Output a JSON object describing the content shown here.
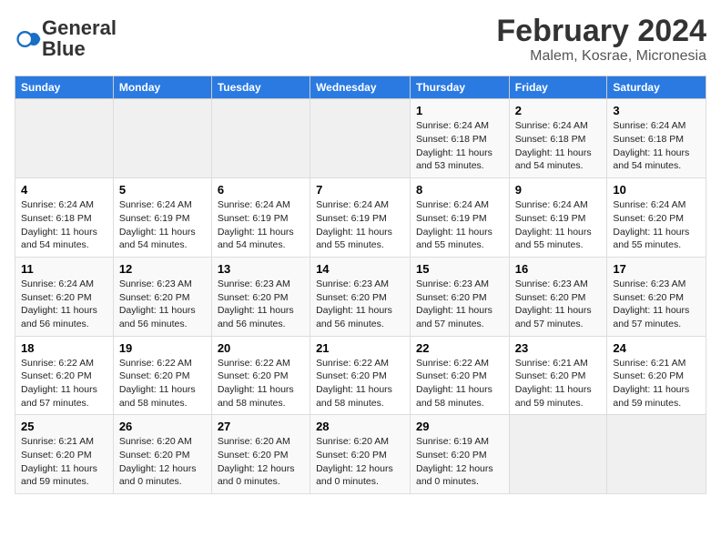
{
  "logo": {
    "text_general": "General",
    "text_blue": "Blue"
  },
  "header": {
    "title": "February 2024",
    "subtitle": "Malem, Kosrae, Micronesia"
  },
  "weekdays": [
    "Sunday",
    "Monday",
    "Tuesday",
    "Wednesday",
    "Thursday",
    "Friday",
    "Saturday"
  ],
  "weeks": [
    [
      {
        "day": "",
        "info": ""
      },
      {
        "day": "",
        "info": ""
      },
      {
        "day": "",
        "info": ""
      },
      {
        "day": "",
        "info": ""
      },
      {
        "day": "1",
        "info": "Sunrise: 6:24 AM\nSunset: 6:18 PM\nDaylight: 11 hours\nand 53 minutes."
      },
      {
        "day": "2",
        "info": "Sunrise: 6:24 AM\nSunset: 6:18 PM\nDaylight: 11 hours\nand 54 minutes."
      },
      {
        "day": "3",
        "info": "Sunrise: 6:24 AM\nSunset: 6:18 PM\nDaylight: 11 hours\nand 54 minutes."
      }
    ],
    [
      {
        "day": "4",
        "info": "Sunrise: 6:24 AM\nSunset: 6:18 PM\nDaylight: 11 hours\nand 54 minutes."
      },
      {
        "day": "5",
        "info": "Sunrise: 6:24 AM\nSunset: 6:19 PM\nDaylight: 11 hours\nand 54 minutes."
      },
      {
        "day": "6",
        "info": "Sunrise: 6:24 AM\nSunset: 6:19 PM\nDaylight: 11 hours\nand 54 minutes."
      },
      {
        "day": "7",
        "info": "Sunrise: 6:24 AM\nSunset: 6:19 PM\nDaylight: 11 hours\nand 55 minutes."
      },
      {
        "day": "8",
        "info": "Sunrise: 6:24 AM\nSunset: 6:19 PM\nDaylight: 11 hours\nand 55 minutes."
      },
      {
        "day": "9",
        "info": "Sunrise: 6:24 AM\nSunset: 6:19 PM\nDaylight: 11 hours\nand 55 minutes."
      },
      {
        "day": "10",
        "info": "Sunrise: 6:24 AM\nSunset: 6:20 PM\nDaylight: 11 hours\nand 55 minutes."
      }
    ],
    [
      {
        "day": "11",
        "info": "Sunrise: 6:24 AM\nSunset: 6:20 PM\nDaylight: 11 hours\nand 56 minutes."
      },
      {
        "day": "12",
        "info": "Sunrise: 6:23 AM\nSunset: 6:20 PM\nDaylight: 11 hours\nand 56 minutes."
      },
      {
        "day": "13",
        "info": "Sunrise: 6:23 AM\nSunset: 6:20 PM\nDaylight: 11 hours\nand 56 minutes."
      },
      {
        "day": "14",
        "info": "Sunrise: 6:23 AM\nSunset: 6:20 PM\nDaylight: 11 hours\nand 56 minutes."
      },
      {
        "day": "15",
        "info": "Sunrise: 6:23 AM\nSunset: 6:20 PM\nDaylight: 11 hours\nand 57 minutes."
      },
      {
        "day": "16",
        "info": "Sunrise: 6:23 AM\nSunset: 6:20 PM\nDaylight: 11 hours\nand 57 minutes."
      },
      {
        "day": "17",
        "info": "Sunrise: 6:23 AM\nSunset: 6:20 PM\nDaylight: 11 hours\nand 57 minutes."
      }
    ],
    [
      {
        "day": "18",
        "info": "Sunrise: 6:22 AM\nSunset: 6:20 PM\nDaylight: 11 hours\nand 57 minutes."
      },
      {
        "day": "19",
        "info": "Sunrise: 6:22 AM\nSunset: 6:20 PM\nDaylight: 11 hours\nand 58 minutes."
      },
      {
        "day": "20",
        "info": "Sunrise: 6:22 AM\nSunset: 6:20 PM\nDaylight: 11 hours\nand 58 minutes."
      },
      {
        "day": "21",
        "info": "Sunrise: 6:22 AM\nSunset: 6:20 PM\nDaylight: 11 hours\nand 58 minutes."
      },
      {
        "day": "22",
        "info": "Sunrise: 6:22 AM\nSunset: 6:20 PM\nDaylight: 11 hours\nand 58 minutes."
      },
      {
        "day": "23",
        "info": "Sunrise: 6:21 AM\nSunset: 6:20 PM\nDaylight: 11 hours\nand 59 minutes."
      },
      {
        "day": "24",
        "info": "Sunrise: 6:21 AM\nSunset: 6:20 PM\nDaylight: 11 hours\nand 59 minutes."
      }
    ],
    [
      {
        "day": "25",
        "info": "Sunrise: 6:21 AM\nSunset: 6:20 PM\nDaylight: 11 hours\nand 59 minutes."
      },
      {
        "day": "26",
        "info": "Sunrise: 6:20 AM\nSunset: 6:20 PM\nDaylight: 12 hours\nand 0 minutes."
      },
      {
        "day": "27",
        "info": "Sunrise: 6:20 AM\nSunset: 6:20 PM\nDaylight: 12 hours\nand 0 minutes."
      },
      {
        "day": "28",
        "info": "Sunrise: 6:20 AM\nSunset: 6:20 PM\nDaylight: 12 hours\nand 0 minutes."
      },
      {
        "day": "29",
        "info": "Sunrise: 6:19 AM\nSunset: 6:20 PM\nDaylight: 12 hours\nand 0 minutes."
      },
      {
        "day": "",
        "info": ""
      },
      {
        "day": "",
        "info": ""
      }
    ]
  ]
}
